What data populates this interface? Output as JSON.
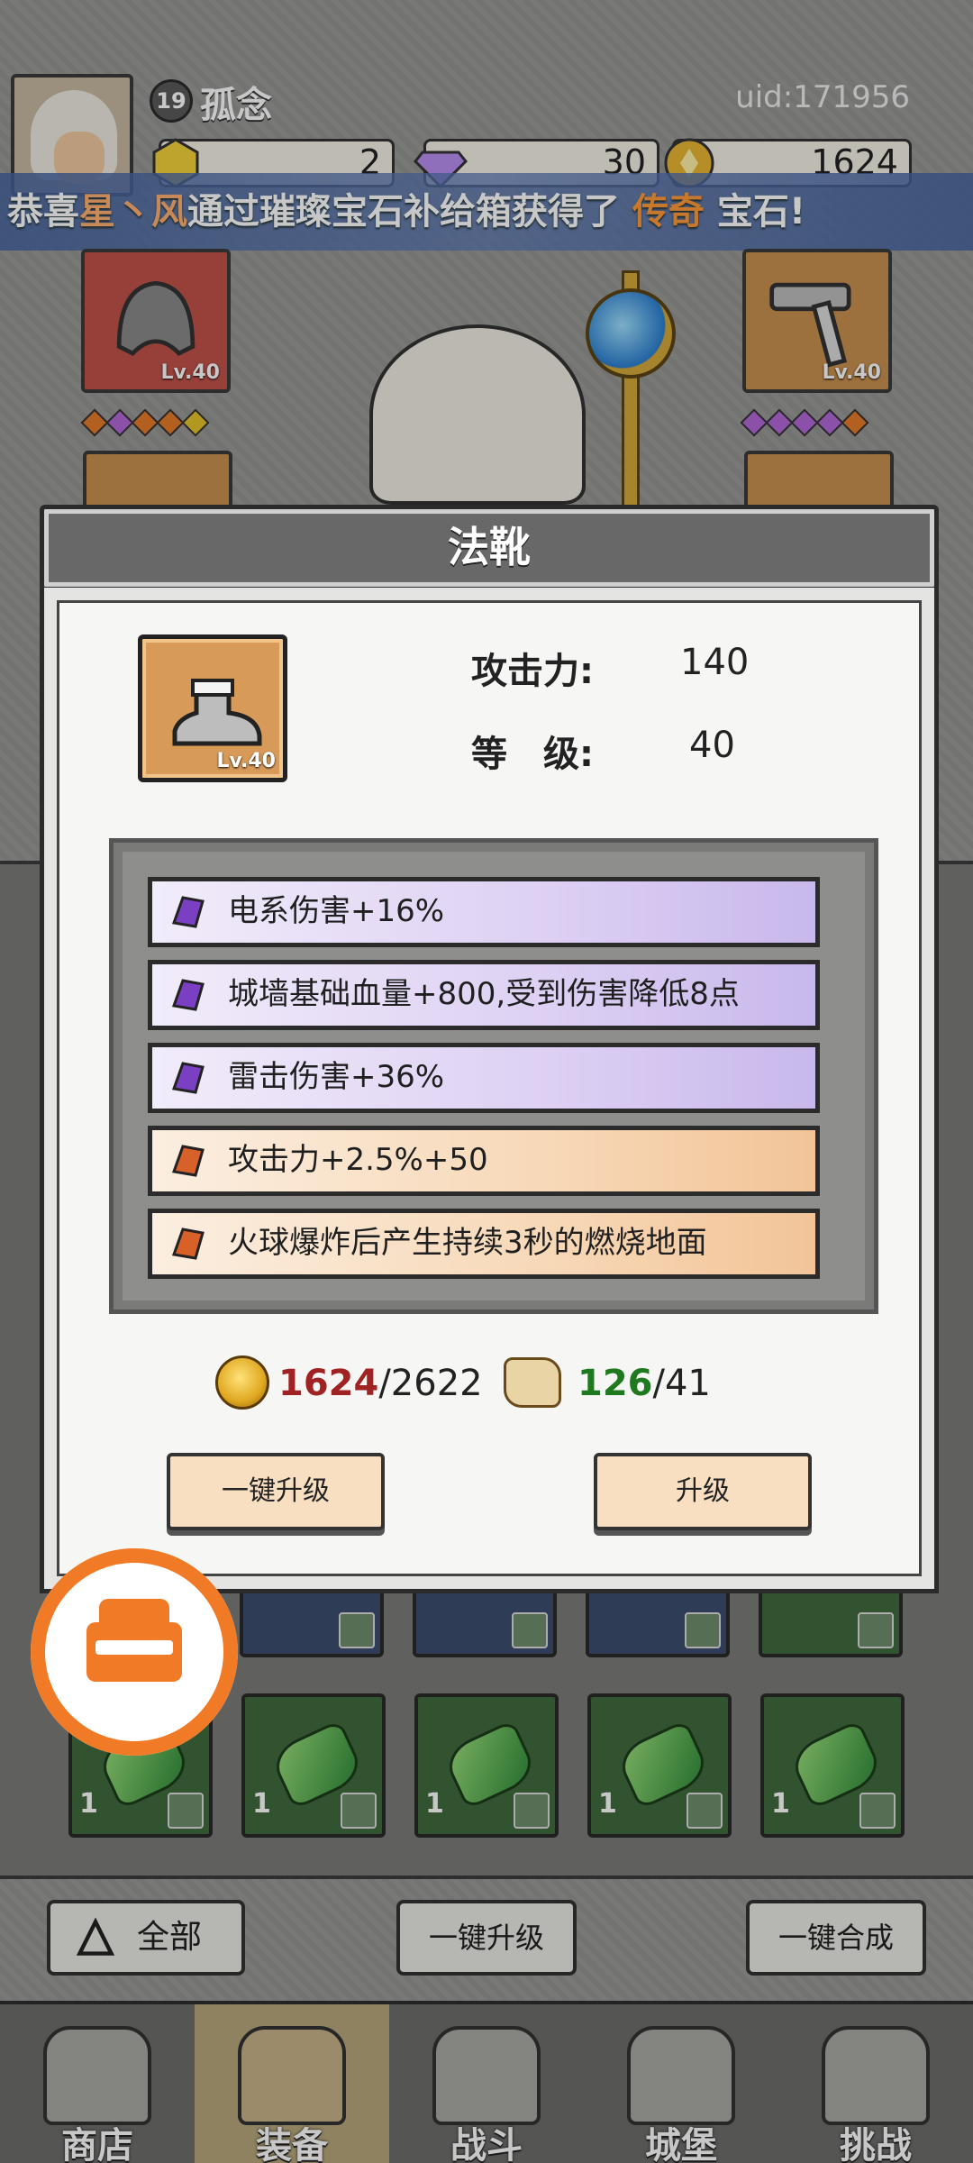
{
  "player": {
    "level": "19",
    "name": "孤念",
    "uid": "uid:171956"
  },
  "resources": [
    {
      "icon": "yellow-gem-icon",
      "value": "2"
    },
    {
      "icon": "purple-gem-icon",
      "value": "30"
    },
    {
      "icon": "gold-coin-icon",
      "value": "1624"
    }
  ],
  "announcement": {
    "prefix": "恭喜",
    "player": "星丶风",
    "middle": "通过璀璨宝石补给箱获得了",
    "rarity": "传奇",
    "suffix": "宝石!"
  },
  "equipment_slots": {
    "top_left_level": "Lv.40",
    "top_right_level": "Lv.40"
  },
  "modal": {
    "title": "法靴",
    "item_level": "Lv.40",
    "stats": [
      {
        "label": "攻击力:",
        "value": "140"
      },
      {
        "label": "等　级:",
        "value": "40"
      }
    ],
    "attributes": [
      {
        "text": "电系伤害+16%",
        "tier": "purple"
      },
      {
        "text": "城墙基础血量+800,受到伤害降低8点",
        "tier": "purple"
      },
      {
        "text": "雷击伤害+36%",
        "tier": "purple"
      },
      {
        "text": "攻击力+2.5%+50",
        "tier": "orange"
      },
      {
        "text": "火球爆炸后产生持续3秒的燃烧地面",
        "tier": "orange"
      }
    ],
    "cost": {
      "gold_have": "1624",
      "gold_need": "/2622",
      "scroll_have": "126",
      "scroll_need": "/41"
    },
    "buttons": {
      "upgrade_all": "一键升级",
      "upgrade": "升级"
    }
  },
  "inventory": {
    "counts": [
      "1",
      "1",
      "1",
      "1",
      "1"
    ]
  },
  "bottom_actions": {
    "all": "全部",
    "upgrade_all": "一键升级",
    "merge_all": "一键合成"
  },
  "nav": [
    {
      "label": "商店",
      "icon": "shop-icon"
    },
    {
      "label": "装备",
      "icon": "backpack-icon"
    },
    {
      "label": "战斗",
      "icon": "crossed-swords-icon"
    },
    {
      "label": "城堡",
      "icon": "castle-icon"
    },
    {
      "label": "挑战",
      "icon": "shield-icon"
    }
  ],
  "colors": {
    "accent_orange": "#f07a25",
    "gold_shortfall": "#a12222",
    "scroll_enough": "#1f7a1f"
  }
}
